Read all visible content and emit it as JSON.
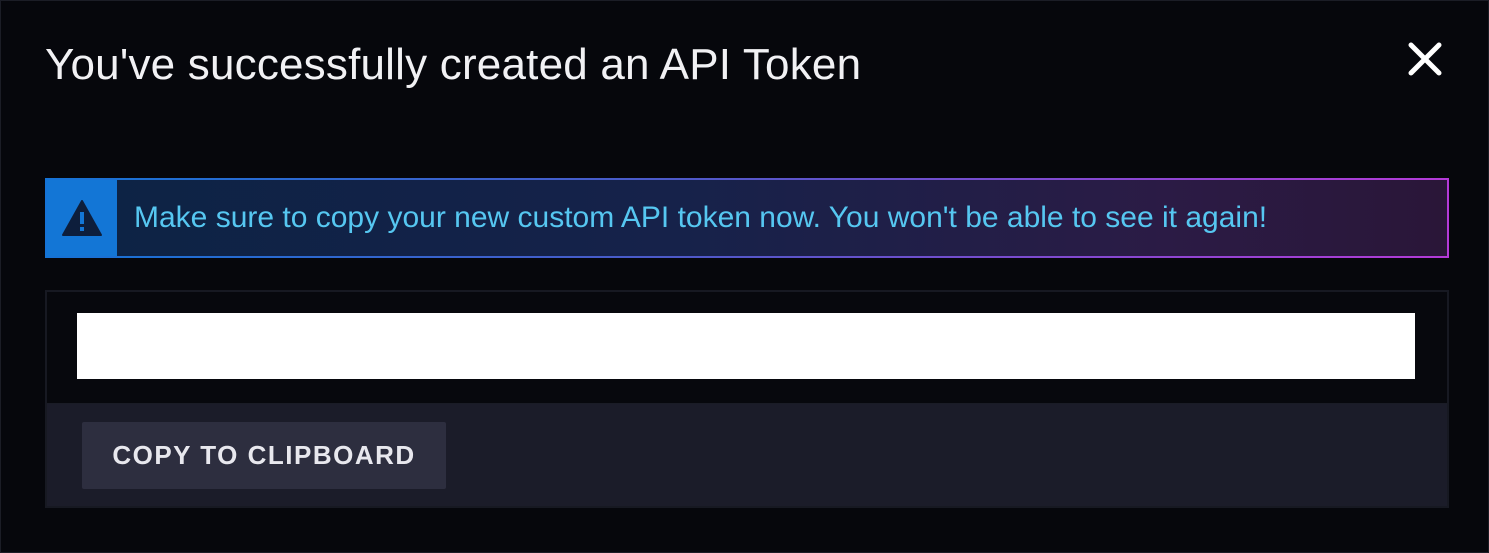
{
  "dialog": {
    "title": "You've successfully created an API Token",
    "close_icon": "close-icon"
  },
  "alert": {
    "icon": "warning-triangle-icon",
    "message": "Make sure to copy your new custom API token now. You won't be able to see it again!",
    "accent_color": "#1376d6",
    "text_color": "#56c7f1"
  },
  "token": {
    "value": ""
  },
  "actions": {
    "copy_label": "COPY TO CLIPBOARD"
  },
  "colors": {
    "background": "#06070c",
    "panel": "#1b1c29",
    "button": "#2d2e3f"
  }
}
